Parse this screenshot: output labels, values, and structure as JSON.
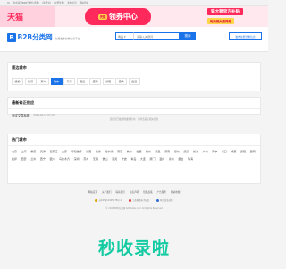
{
  "topbar": {
    "items": [
      "Hi,",
      "欢迎来到B2B分类信息网!",
      "[请登录]",
      "[免费注册]",
      "发布信息",
      "网站导航"
    ]
  },
  "banner": {
    "brand": "天猫",
    "coupon": "领券中心",
    "coupon_tag": "天猫",
    "promo1": "猫大额官方补贴",
    "promo2": "每天领大额神券"
  },
  "header": {
    "logo_mark": "B",
    "logo_text": "B2B分类网",
    "slogan": "免费发布分类信息平台",
    "search_select": "商品",
    "search_placeholder": "请输入关键词",
    "search_button": "搜索",
    "publish_button": "发布免费分类信息"
  },
  "near_cities": {
    "title": "周边城市",
    "items": [
      "赣榆",
      "新沂",
      "邳州",
      "睢宁",
      "东海",
      "灌云",
      "灌南",
      "沭阳",
      "泗洪",
      "宿迁"
    ],
    "active_index": 3
  },
  "latest": {
    "title": "最新修正供应",
    "item_title": "测试文章标题",
    "item_time": "2024-04-16 07:10"
  },
  "notice": "该信息已被删除或审核中，请浏览其它相关信息",
  "hot_cities": {
    "title": "热门城市",
    "items": [
      "北京",
      "上海",
      "重庆",
      "天津",
      "石家庄",
      "太原",
      "呼和浩特",
      "沈阳",
      "长春",
      "哈尔滨",
      "南京",
      "杭州",
      "合肥",
      "福州",
      "南昌",
      "济南",
      "郑州",
      "武汉",
      "长沙",
      "广州",
      "南宁",
      "海口",
      "成都",
      "贵阳",
      "昆明",
      "拉萨",
      "西安",
      "兰州",
      "西宁",
      "银川",
      "乌鲁木齐",
      "深圳",
      "苏州",
      "无锡",
      "佛山",
      "东莞",
      "宁波",
      "青岛",
      "大连",
      "厦门",
      "温州",
      "泉州",
      "烟台",
      "珠海"
    ]
  },
  "footer": {
    "links": [
      "网站首页",
      "关于我们",
      "联系我们",
      "免责声明",
      "隐私政策",
      "广告服务",
      "网站地图"
    ],
    "reg1": "苏ICP备12345678号-1",
    "reg2": "工商网监电子标识",
    "reg3": "网上营业执照",
    "copyright": "© 2024 B2B分类网 b2bfenlei.com All Rights Reserved"
  },
  "watermark": "秒收录啦",
  "colors": {
    "primary": "#1a73e8",
    "tmall": "#ff2a5b",
    "watermark": "#12cba2"
  }
}
